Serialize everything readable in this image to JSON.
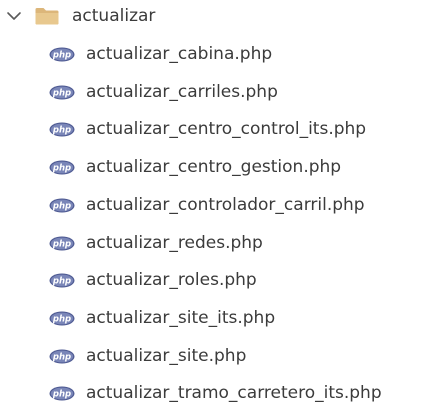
{
  "explorer": {
    "folder": {
      "name": "actualizar",
      "expanded": true,
      "chevron_icon": "chevron-down-icon",
      "folder_icon": "folder-icon",
      "folder_color": "#dcb67a"
    },
    "files": [
      {
        "name": "actualizar_cabina.php",
        "icon": "php-file-icon"
      },
      {
        "name": "actualizar_carriles.php",
        "icon": "php-file-icon"
      },
      {
        "name": "actualizar_centro_control_its.php",
        "icon": "php-file-icon"
      },
      {
        "name": "actualizar_centro_gestion.php",
        "icon": "php-file-icon"
      },
      {
        "name": "actualizar_controlador_carril.php",
        "icon": "php-file-icon"
      },
      {
        "name": "actualizar_redes.php",
        "icon": "php-file-icon"
      },
      {
        "name": "actualizar_roles.php",
        "icon": "php-file-icon"
      },
      {
        "name": "actualizar_site_its.php",
        "icon": "php-file-icon"
      },
      {
        "name": "actualizar_site.php",
        "icon": "php-file-icon"
      },
      {
        "name": "actualizar_tramo_carretero_its.php",
        "icon": "php-file-icon"
      }
    ],
    "php_icon_text": "php",
    "php_icon_color": "#6b7bb3"
  }
}
